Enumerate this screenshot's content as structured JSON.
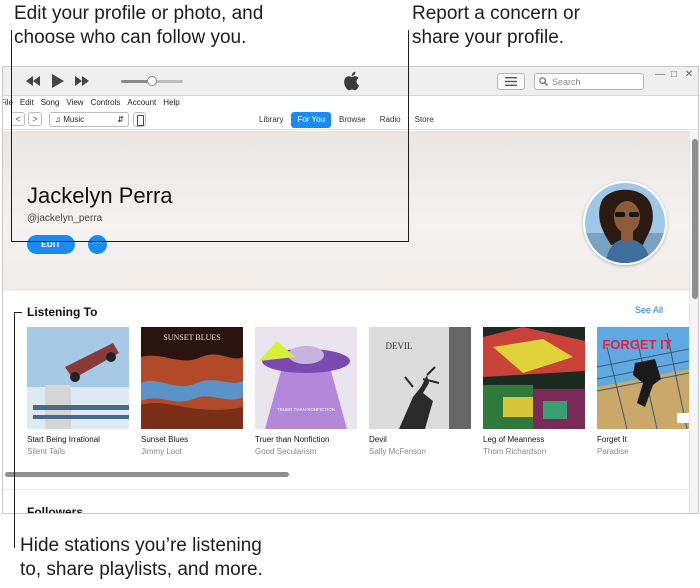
{
  "callouts": {
    "top_left_line1": "Edit your profile or photo, and",
    "top_left_line2": "choose who can follow you.",
    "top_right_line1": "Report a concern or",
    "top_right_line2": "share your profile.",
    "bottom_line1": "Hide stations you’re listening",
    "bottom_line2": "to, share playlists, and more."
  },
  "toolbar": {
    "search_placeholder": "Search",
    "playback_progress": 0.5
  },
  "menu": [
    "File",
    "Edit",
    "Song",
    "View",
    "Controls",
    "Account",
    "Help"
  ],
  "nav": {
    "back": "<",
    "forward": ">",
    "media_kind": "Music",
    "tabs": [
      "Library",
      "For You",
      "Browse",
      "Radio",
      "Store"
    ],
    "active_tab": "For You"
  },
  "profile": {
    "name": "Jackelyn Perra",
    "handle": "@jackelyn_perra",
    "edit_label": "EDIT",
    "more_label": "···"
  },
  "listening": {
    "title": "Listening To",
    "see_all": "See All",
    "albums": [
      {
        "title": "Start Being Irrational",
        "artist": "Silent Tails",
        "art_text": ""
      },
      {
        "title": "Sunset Blues",
        "artist": "Jimmy Loot",
        "art_text": "SUNSET BLUES"
      },
      {
        "title": "Truer than Nonfiction",
        "artist": "Good Secularism",
        "art_text": "TRUER THAN NONFICTION"
      },
      {
        "title": "Devil",
        "artist": "Sally McFenson",
        "art_text": "DEVIL"
      },
      {
        "title": "Leg of Meanness",
        "artist": "Thom Richardson",
        "art_text": ""
      },
      {
        "title": "Forget It",
        "artist": "Paradise",
        "art_text": "FORGET IT"
      }
    ]
  },
  "followers": {
    "title": "Followers"
  },
  "colors": {
    "accent": "#1a8cf0",
    "link": "#1a7ae0"
  }
}
